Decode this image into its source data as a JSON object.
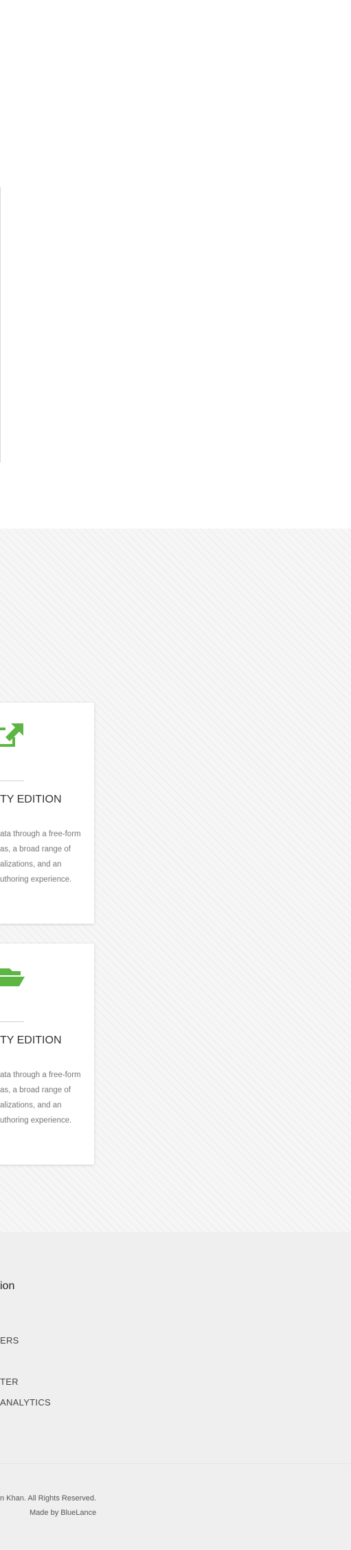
{
  "cards": [
    {
      "icon": "external-link-arrow-icon",
      "title": "TY EDITION",
      "desc": [
        "ata through a free-form",
        "as, a broad range of",
        "alizations, and an",
        "uthoring experience."
      ]
    },
    {
      "icon": "folder-open-icon",
      "title": "TY EDITION",
      "desc": [
        "ata through a free-form",
        "as, a broad range of",
        "alizations, and an",
        "uthoring experience."
      ]
    }
  ],
  "footer": {
    "heading": "ion",
    "links": [
      "ERS",
      "TER",
      "ANALYTICS"
    ]
  },
  "bottom": {
    "copyright": "n Khan. All Rights Reserved.",
    "made_by": "Made by BlueLance"
  },
  "colors": {
    "accent_green": "#5db544"
  }
}
